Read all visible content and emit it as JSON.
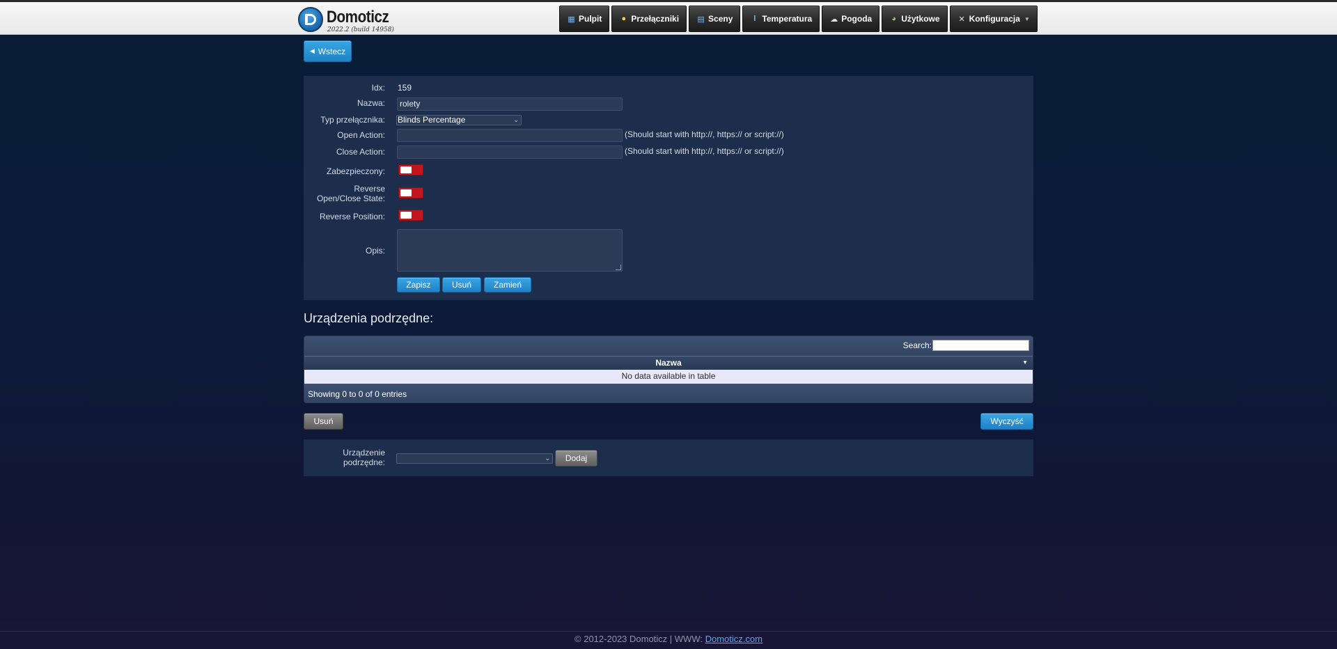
{
  "header": {
    "logo_name": "Domoticz",
    "logo_version": "2022.2 (build 14958)",
    "nav": [
      {
        "label": "Pulpit",
        "icon": "dashboard-icon"
      },
      {
        "label": "Przełączniki",
        "icon": "lightbulb-icon"
      },
      {
        "label": "Sceny",
        "icon": "scenes-icon"
      },
      {
        "label": "Temperatura",
        "icon": "thermometer-icon"
      },
      {
        "label": "Pogoda",
        "icon": "weather-cloud-icon"
      },
      {
        "label": "Użytkowe",
        "icon": "utility-icon"
      },
      {
        "label": "Konfiguracja",
        "icon": "tools-icon"
      }
    ]
  },
  "back_label": "Wstecz",
  "form": {
    "idx_label": "Idx:",
    "idx_value": "159",
    "name_label": "Nazwa:",
    "name_value": "rolety",
    "type_label": "Typ przełącznika:",
    "type_value": "Blinds Percentage",
    "open_action_label": "Open Action:",
    "open_action_value": "",
    "open_action_hint": "(Should start with http://, https:// or script://)",
    "close_action_label": "Close Action:",
    "close_action_value": "",
    "close_action_hint": "(Should start with http://, https:// or script://)",
    "protected_label": "Zabezpieczony:",
    "reverse_state_label_1": "Reverse",
    "reverse_state_label_2": "Open/Close State:",
    "reverse_position_label": "Reverse Position:",
    "description_label": "Opis:",
    "description_value": "",
    "save_label": "Zapisz",
    "delete_label": "Usuń",
    "replace_label": "Zamień"
  },
  "subdevices": {
    "heading": "Urządzenia podrzędne:",
    "search_label": "Search:",
    "search_value": "",
    "column_name": "Nazwa",
    "empty_text": "No data available in table",
    "info_text": "Showing 0 to 0 of 0 entries",
    "delete_label": "Usuń",
    "clear_label": "Wyczyść",
    "add_label_1": "Urządzenie",
    "add_label_2": "podrzędne:",
    "add_select_value": "",
    "add_button_label": "Dodaj"
  },
  "footer": {
    "text": "© 2012-2023 Domoticz | WWW: ",
    "link": "Domoticz.com"
  },
  "colors": {
    "accent_blue": "#1f82c6",
    "toggle_off_red": "#c4161c",
    "link": "#5aa6ee"
  }
}
